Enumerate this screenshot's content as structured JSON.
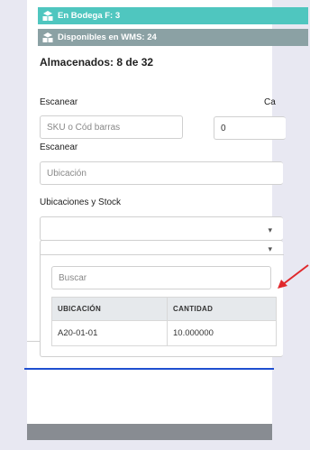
{
  "badges": {
    "en_bodega": "En Bodega F: 3",
    "disponibles": "Disponibles en WMS: 24"
  },
  "almacenados": "Almacenados: 8 de 32",
  "scan_sku": {
    "label": "Escanear",
    "placeholder": "SKU o Cód barras"
  },
  "cantidad": {
    "label_fragment": "Ca",
    "value": "0"
  },
  "scan_ubicacion": {
    "label": "Escanear",
    "placeholder": "Ubicación"
  },
  "ubicaciones_stock": {
    "label": "Ubicaciones y Stock",
    "search_placeholder": "Buscar",
    "columns": [
      "UBICACIÓN",
      "CANTIDAD"
    ],
    "rows": [
      {
        "ubicacion": "A20-01-01",
        "cantidad": "10.000000"
      }
    ]
  },
  "colors": {
    "teal_badge": "#4fc6bf",
    "gray_badge": "#8ba1a4",
    "annotation_arrow": "#e0282c",
    "annotation_line": "#1f4fd0"
  },
  "icons": [
    "warehouse-boxes-icon",
    "chevron-down-icon",
    "red-arrow-annotation"
  ]
}
